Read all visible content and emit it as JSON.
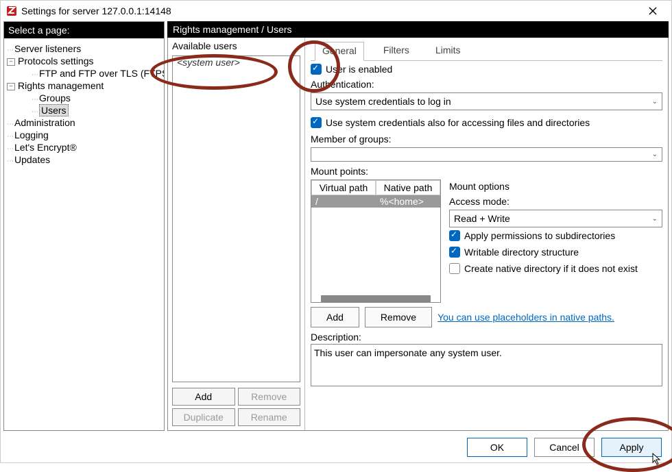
{
  "window": {
    "title": "Settings for server 127.0.0.1:14148"
  },
  "sidebar": {
    "header": "Select a page:",
    "items": [
      {
        "label": "Server listeners"
      },
      {
        "label": "Protocols settings",
        "expandable": true
      },
      {
        "label": "FTP and FTP over TLS (FTPS)"
      },
      {
        "label": "Rights management",
        "expandable": true
      },
      {
        "label": "Groups"
      },
      {
        "label": "Users",
        "selected": true
      },
      {
        "label": "Administration"
      },
      {
        "label": "Logging"
      },
      {
        "label": "Let's Encrypt®"
      },
      {
        "label": "Updates"
      }
    ]
  },
  "panel": {
    "header": "Rights management / Users",
    "available_label": "Available users",
    "available_items": [
      {
        "label": "<system user>"
      }
    ],
    "buttons": {
      "add": "Add",
      "remove": "Remove",
      "duplicate": "Duplicate",
      "rename": "Rename"
    }
  },
  "tabs": {
    "general": "General",
    "filters": "Filters",
    "limits": "Limits"
  },
  "general": {
    "user_enabled_label": "User is enabled",
    "user_enabled": true,
    "authentication_label": "Authentication:",
    "authentication_value": "Use system credentials to log in",
    "use_sys_creds_files_label": "Use system credentials also for accessing files and directories",
    "use_sys_creds_files": true,
    "member_groups_label": "Member of groups:",
    "member_groups_value": "",
    "mount_points_label": "Mount points:",
    "mount_table": {
      "cols": {
        "virtual": "Virtual path",
        "native": "Native path"
      },
      "rows": [
        {
          "virtual": "/",
          "native": "%<home>"
        }
      ]
    },
    "mount_options_label": "Mount options",
    "access_mode_label": "Access mode:",
    "access_mode_value": "Read + Write",
    "apply_perms_label": "Apply permissions to subdirectories",
    "apply_perms": true,
    "writable_struct_label": "Writable directory structure",
    "writable_struct": true,
    "create_native_label": "Create native directory if it does not exist",
    "create_native": false,
    "add_btn": "Add",
    "remove_btn": "Remove",
    "placeholders_link": "You can use placeholders in native paths.",
    "description_label": "Description:",
    "description_value": "This user can impersonate any system user."
  },
  "footer": {
    "ok": "OK",
    "cancel": "Cancel",
    "apply": "Apply"
  }
}
